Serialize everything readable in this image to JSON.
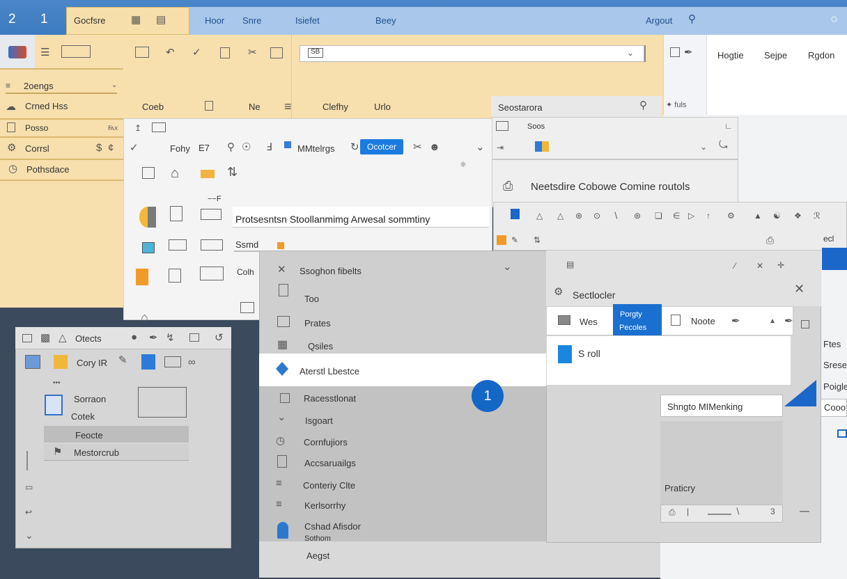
{
  "titlebar": {
    "num1": "2",
    "num2": "1",
    "active_tab": "Gocfsre",
    "tabs": [
      "Hoor",
      "Snre",
      "Isiefet",
      "Beey"
    ],
    "right_label": "Argout"
  },
  "ribbon": {
    "search_value": "SB",
    "groups": [
      "Coeb",
      "Ne",
      "Clefhy",
      "Urlo"
    ],
    "far_tabs": [
      "Hogtie",
      "Sejpe",
      "Rgdon"
    ],
    "section_header": "Seostarora",
    "section_header2": "Soos"
  },
  "leftnav": {
    "items": [
      "2oengs",
      "Crned Hss",
      "Posso",
      "Corrsl",
      "Pothsdace"
    ]
  },
  "center": {
    "toolbar_items": [
      "Fohy",
      "E7",
      "MMtelrgs",
      "Ocotcer"
    ],
    "title": "Protsesntsn Stoollanmimg Arwesal sommtiny",
    "item1": "Ssmd",
    "item2": "Colh",
    "tag": "Neetsdire Cobowe Comine routols"
  },
  "objects": {
    "title": "Otects",
    "copy_label": "Cory IR",
    "item_a": "Sorraon",
    "item_b": "Cotek",
    "selected": "Feocte",
    "item_c": "Mestorcrub"
  },
  "list": {
    "header": "Ssoghon fibelts",
    "items": [
      "Too",
      "Prates",
      "Qsiles",
      "Aterstl Lbestce",
      "Racesstlonat",
      "Isgoart",
      "Cornfujiors",
      "Accsaruailgs",
      "Conteriy Clte",
      "Kerlsorrhy",
      "Cshad Afisdor",
      "Sothom",
      "Aegst"
    ],
    "badge": "1"
  },
  "popup": {
    "title": "Sectlocler",
    "tab_left": "Wes",
    "tab_active_l1": "Porgty",
    "tab_active_l2": "Pecoles",
    "tab_right": "Noote",
    "row": "S roll",
    "field": "Shngto MIMenking",
    "lower": "Praticry",
    "right_side": [
      "Ftes",
      "Srese",
      "Poigle",
      "Cooo"
    ]
  },
  "colors": {
    "accent_blue": "#1a6fd0",
    "ribbon_yellow": "#f7dfae",
    "titlebar_blue": "#3d7bc0"
  }
}
